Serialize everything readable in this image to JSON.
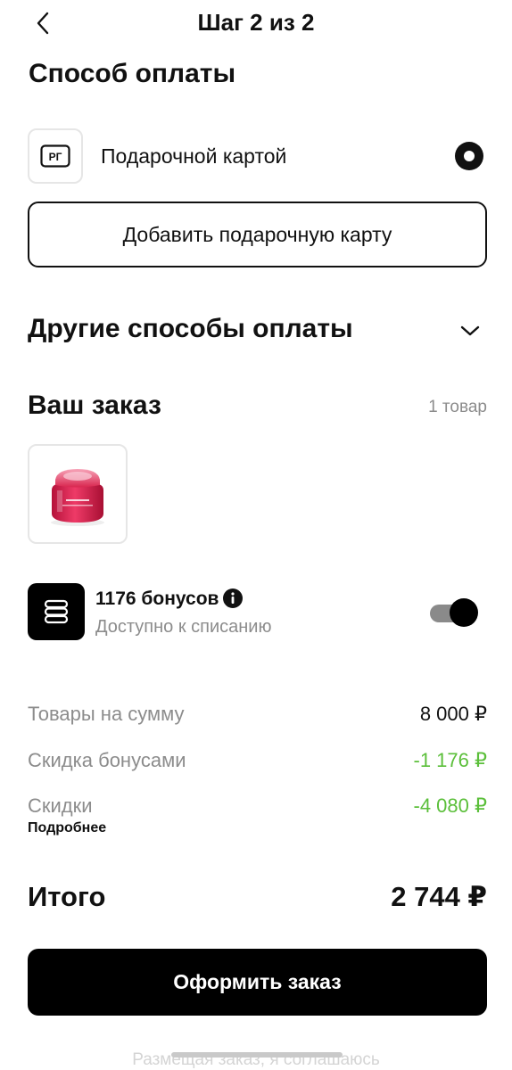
{
  "header": {
    "title": "Шаг 2 из 2"
  },
  "payment": {
    "section_title": "Способ оплаты",
    "option_icon_text": "РГ",
    "option_label": "Подарочной картой",
    "add_card_label": "Добавить подарочную карту",
    "other_methods_label": "Другие способы оплаты"
  },
  "order": {
    "title": "Ваш заказ",
    "count": "1 товар"
  },
  "bonus": {
    "title": "1176 бонусов",
    "subtitle": "Доступно к списанию",
    "enabled": true
  },
  "summary": {
    "items_label": "Товары на сумму",
    "items_value": "8 000 ₽",
    "bonus_discount_label": "Скидка бонусами",
    "bonus_discount_value": "-1 176 ₽",
    "discounts_label": "Скидки",
    "discounts_value": "-4 080 ₽",
    "details_label": "Подробнее",
    "total_label": "Итого",
    "total_value": "2 744 ₽"
  },
  "checkout_button": "Оформить заказ",
  "footer_note": "Размещая заказ, я соглашаюсь",
  "colors": {
    "accent": "#000000",
    "discount_green": "#5bbf3a",
    "muted_text": "#8c8c8c",
    "border": "#e6e6e6"
  }
}
